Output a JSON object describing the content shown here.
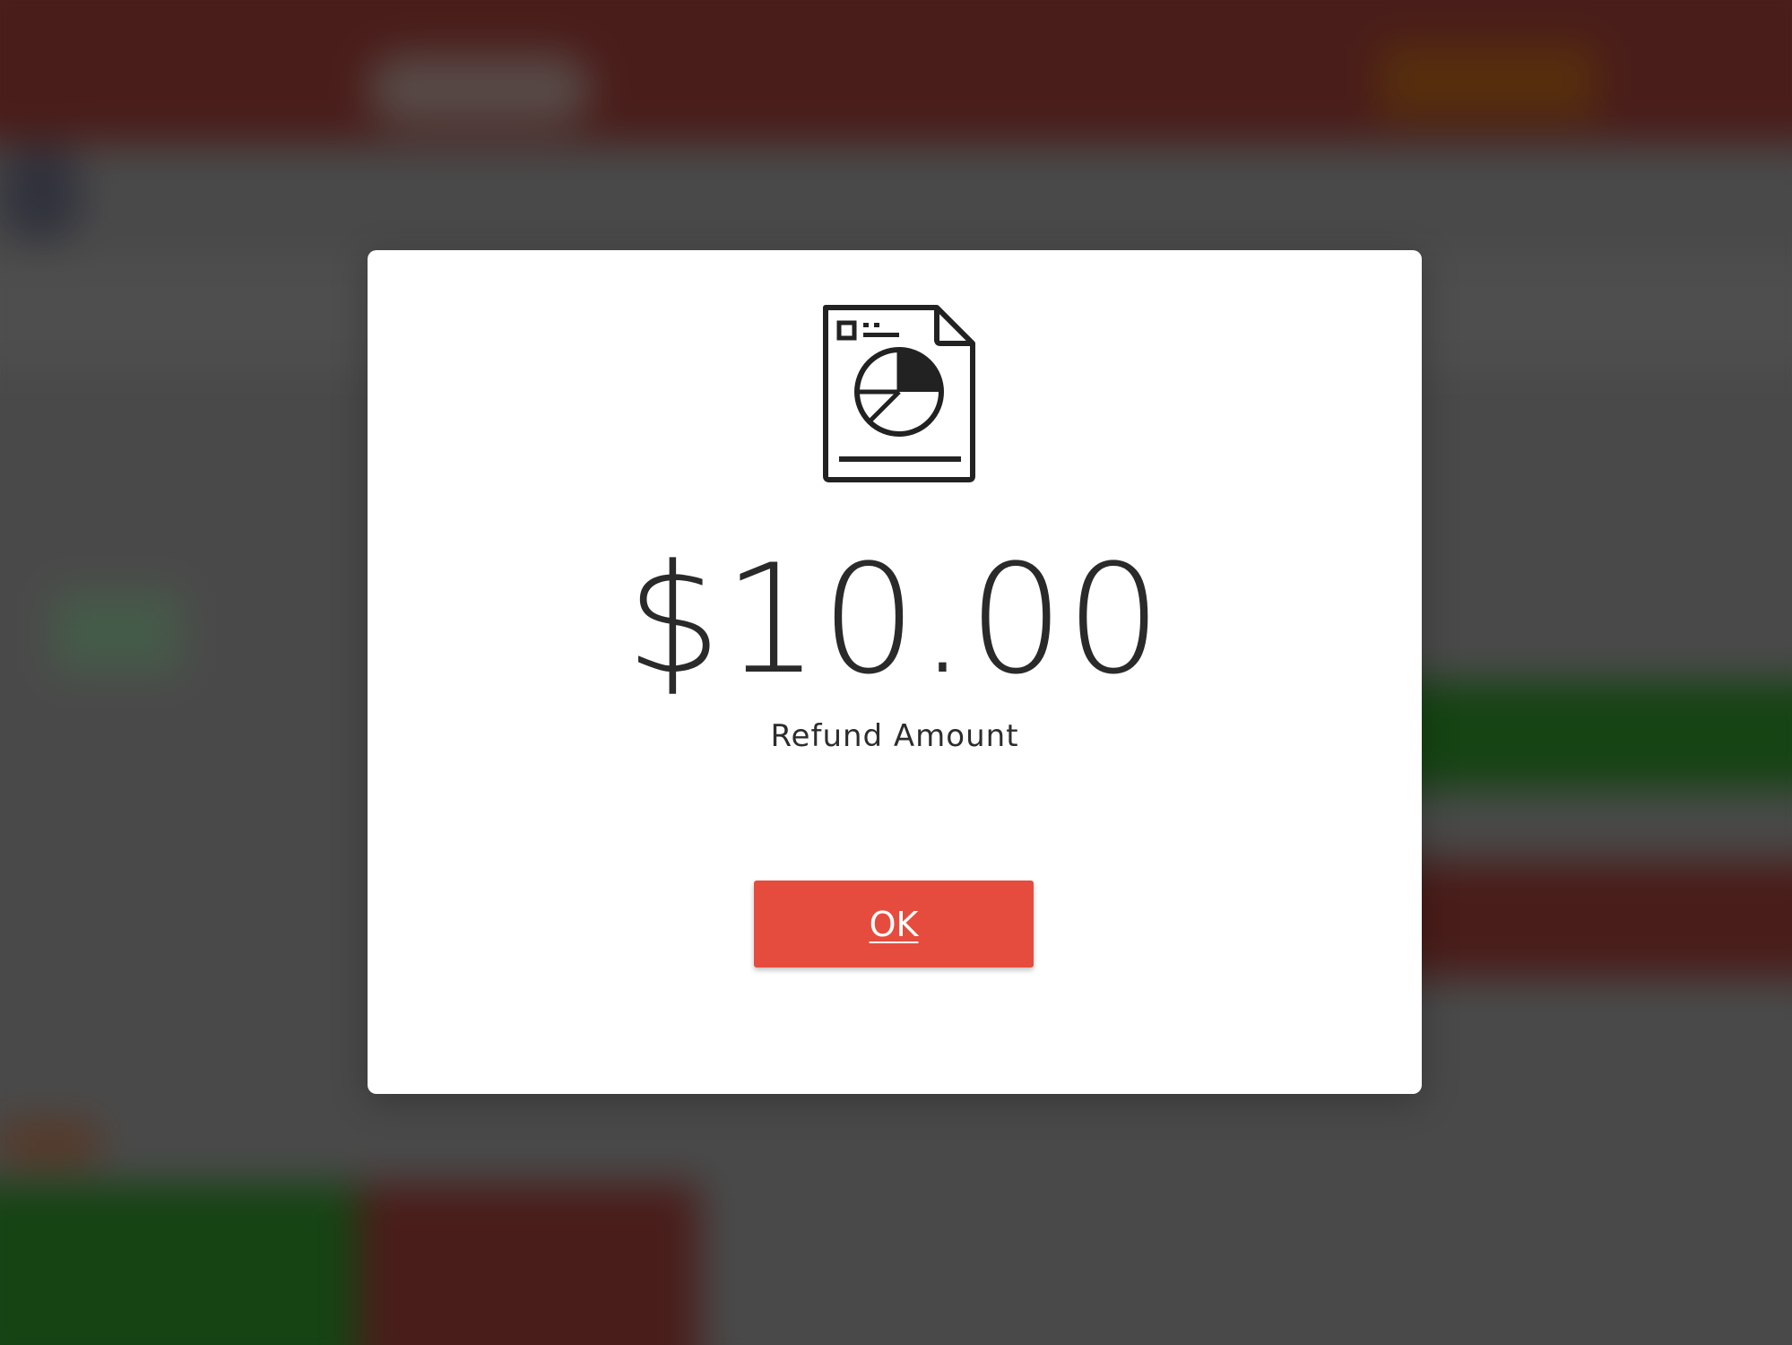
{
  "dialog": {
    "icon": "report-document-pie-chart-icon",
    "amount": "$10.00",
    "amount_label": "Refund Amount",
    "ok_label": "OK"
  },
  "colors": {
    "ok_button": "#e64c3e",
    "amount_text": "#2a2a2a",
    "modal_background": "#ffffff",
    "backdrop_red": "#5a2420",
    "backdrop_green": "#1b5318"
  }
}
